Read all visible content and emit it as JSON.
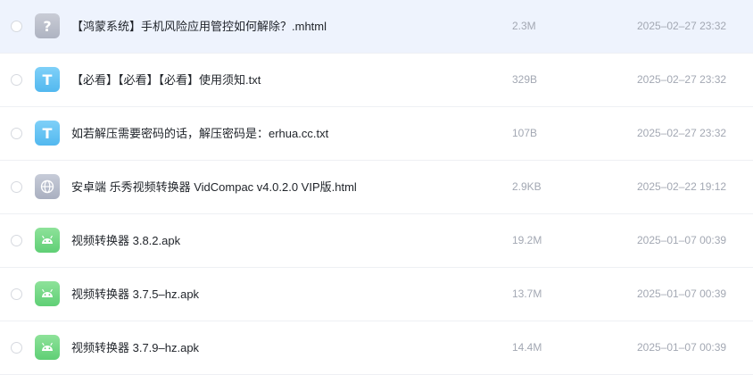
{
  "files": [
    {
      "icon": "question-file-icon",
      "icon_glyph": "?",
      "type": "unknown",
      "name": "【鸿蒙系统】手机风险应用管控如何解除？.mhtml",
      "size": "2.3M",
      "date": "2025–02–27 23:32",
      "selected": true
    },
    {
      "icon": "text-file-icon",
      "icon_glyph": "T",
      "type": "txt",
      "name": "【必看】【必看】【必看】使用须知.txt",
      "size": "329B",
      "date": "2025–02–27 23:32",
      "selected": false
    },
    {
      "icon": "text-file-icon",
      "icon_glyph": "T",
      "type": "txt",
      "name": "如若解压需要密码的话，解压密码是：erhua.cc.txt",
      "size": "107B",
      "date": "2025–02–27 23:32",
      "selected": false
    },
    {
      "icon": "globe-file-icon",
      "icon_glyph": "",
      "type": "html",
      "name": "安卓端 乐秀视频转换器 VidCompac v4.0.2.0 VIP版.html",
      "size": "2.9KB",
      "date": "2025–02–22 19:12",
      "selected": false
    },
    {
      "icon": "android-file-icon",
      "icon_glyph": "",
      "type": "apk",
      "name": "视频转换器 3.8.2.apk",
      "size": "19.2M",
      "date": "2025–01–07 00:39",
      "selected": false
    },
    {
      "icon": "android-file-icon",
      "icon_glyph": "",
      "type": "apk",
      "name": "视频转换器 3.7.5–hz.apk",
      "size": "13.7M",
      "date": "2025–01–07 00:39",
      "selected": false
    },
    {
      "icon": "android-file-icon",
      "icon_glyph": "",
      "type": "apk",
      "name": "视频转换器 3.7.9–hz.apk",
      "size": "14.4M",
      "date": "2025–01–07 00:39",
      "selected": false
    }
  ],
  "colors": {
    "selected_row": "#eef3fd",
    "txt_icon": "#52b8ef",
    "apk_icon": "#5fcf75",
    "unknown_icon": "#aeb3c1",
    "meta_text": "#a3a8b3"
  }
}
